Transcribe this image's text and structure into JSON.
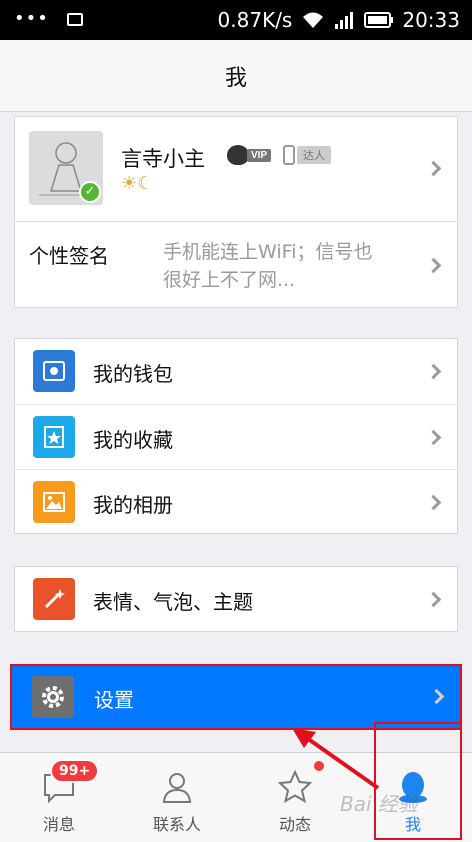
{
  "status_bar": {
    "dots": "•••",
    "network_speed": "0.87K/s",
    "time": "20:33"
  },
  "nav": {
    "title": "我"
  },
  "profile": {
    "nickname": "言寺小主",
    "vip_label": "VIP",
    "phone_tag": "达人",
    "weather": "☀☾",
    "signature_label": "个性签名",
    "signature_text": "手机能连上WiFi；信号也很好上不了网..."
  },
  "menu": {
    "items": [
      {
        "label": "我的钱包",
        "color": "#2c7ad6"
      },
      {
        "label": "我的收藏",
        "color": "#1da8e8"
      },
      {
        "label": "我的相册",
        "color": "#f59b1d"
      }
    ]
  },
  "themes": {
    "label": "表情、气泡、主题",
    "color": "#e9532b"
  },
  "settings": {
    "label": "设置",
    "color": "#0078ff"
  },
  "tabbar": {
    "tabs": [
      {
        "label": "消息",
        "badge": "99+"
      },
      {
        "label": "联系人"
      },
      {
        "label": "动态"
      },
      {
        "label": "我",
        "active": true
      }
    ]
  },
  "watermark": {
    "text": "Bai 经验"
  }
}
